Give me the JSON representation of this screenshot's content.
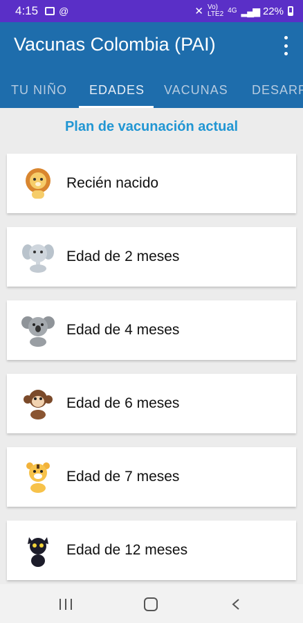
{
  "status_bar": {
    "time": "4:15",
    "network_label_top": "Vo)",
    "network_label_bottom": "LTE2",
    "network_gen": "4G",
    "battery_percent": "22%",
    "icons": [
      "message-icon",
      "sync-icon",
      "mute-icon",
      "wifi-calling-icon",
      "signal-icon",
      "battery-icon"
    ]
  },
  "app_bar": {
    "title": "Vacunas Colombia (PAI)",
    "menu_icon": "more-vert-icon",
    "color": "#1e6dac"
  },
  "tabs": [
    {
      "label": "TU NIÑO",
      "active": false
    },
    {
      "label": "EDADES",
      "active": true
    },
    {
      "label": "VACUNAS",
      "active": false
    },
    {
      "label": "DESARROLLO",
      "active": false
    }
  ],
  "section": {
    "heading": "Plan de vacunación actual",
    "heading_color": "#2196d3"
  },
  "age_items": [
    {
      "label": "Recién nacido",
      "icon": "lion-icon"
    },
    {
      "label": "Edad de 2 meses",
      "icon": "elephant-icon"
    },
    {
      "label": "Edad de 4 meses",
      "icon": "koala-icon"
    },
    {
      "label": "Edad de 6 meses",
      "icon": "monkey-icon"
    },
    {
      "label": "Edad de 7 meses",
      "icon": "tiger-icon"
    },
    {
      "label": "Edad de 12 meses",
      "icon": "cat-icon"
    }
  ],
  "nav_bar": {
    "icons": [
      "recent-apps-icon",
      "home-icon",
      "back-icon"
    ]
  }
}
